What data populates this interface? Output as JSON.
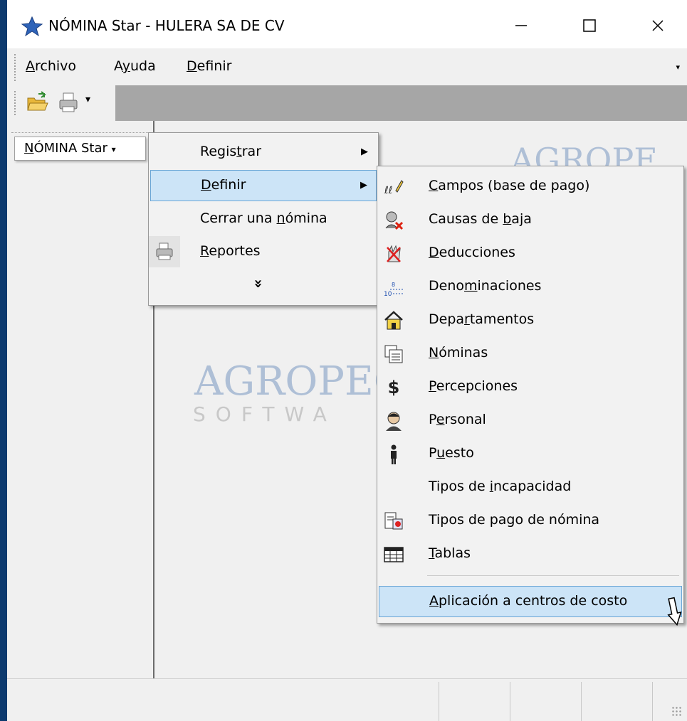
{
  "window": {
    "title": "NÓMINA Star - HULERA SA DE CV",
    "app_icon": "star-icon",
    "controls": [
      "minimize-icon",
      "maximize-icon",
      "close-icon"
    ]
  },
  "menubar": {
    "items": [
      {
        "pre": "",
        "u": "A",
        "post": "rchivo"
      },
      {
        "pre": "A",
        "u": "y",
        "post": "uda"
      },
      {
        "pre": "",
        "u": "D",
        "post": "efinir"
      }
    ]
  },
  "toolbar": {
    "icons": [
      "open-folder-icon",
      "print-icon"
    ]
  },
  "left_pane": {
    "button": {
      "pre": "",
      "u": "N",
      "post": "ÓMINA Star"
    }
  },
  "watermark": {
    "title_top": "AGROPE",
    "title_main": "AGROPEC",
    "subtitle": "SOFTWA"
  },
  "menu1": {
    "items": [
      {
        "pre": "Regis",
        "u": "t",
        "post": "rar",
        "submenu": true,
        "icon": ""
      },
      {
        "pre": "",
        "u": "D",
        "post": "efinir",
        "submenu": true,
        "icon": "",
        "highlighted": true
      },
      {
        "pre": "Cerrar una ",
        "u": "n",
        "post": "ómina",
        "submenu": false,
        "icon": ""
      },
      {
        "pre": "",
        "u": "R",
        "post": "eportes",
        "submenu": false,
        "icon": "printer-icon"
      }
    ],
    "expand": "»"
  },
  "menu2": {
    "items": [
      {
        "pre": "",
        "u": "C",
        "post": "ampos (base de pago)",
        "icon": "fields-icon"
      },
      {
        "pre": "Causas de ",
        "u": "b",
        "post": "aja",
        "icon": "person-remove-icon"
      },
      {
        "pre": "",
        "u": "D",
        "post": "educciones",
        "icon": "deductions-icon"
      },
      {
        "pre": "Deno",
        "u": "m",
        "post": "inaciones",
        "icon": "denominations-icon"
      },
      {
        "pre": "Depa",
        "u": "r",
        "post": "tamentos",
        "icon": "house-icon"
      },
      {
        "pre": "",
        "u": "N",
        "post": "óminas",
        "icon": "payrolls-icon"
      },
      {
        "pre": "",
        "u": "P",
        "post": "ercepciones",
        "icon": "dollar-icon"
      },
      {
        "pre": "P",
        "u": "e",
        "post": "rsonal",
        "icon": "person-icon"
      },
      {
        "pre": "P",
        "u": "u",
        "post": "esto",
        "icon": "position-icon"
      },
      {
        "pre": "Tipos de ",
        "u": "i",
        "post": "ncapacidad",
        "icon": ""
      },
      {
        "pre": "Tipos de pago de nómina",
        "u": "",
        "post": "",
        "icon": "payment-types-icon"
      },
      {
        "pre": "",
        "u": "T",
        "post": "ablas",
        "icon": "table-icon"
      },
      {
        "pre": "",
        "u": "A",
        "post": "plicación a centros de costo",
        "icon": "",
        "highlighted": true
      }
    ]
  }
}
